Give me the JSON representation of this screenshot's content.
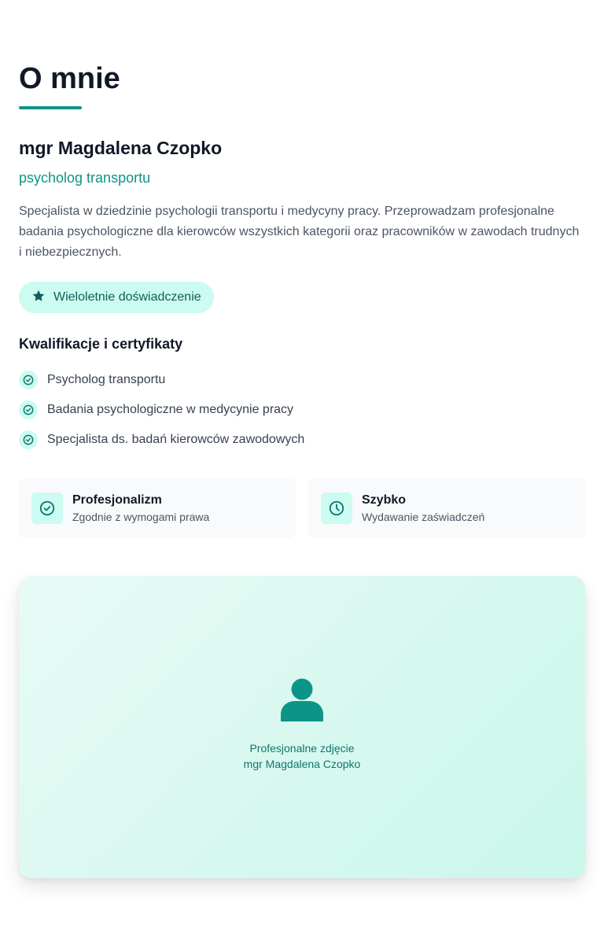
{
  "section": {
    "title": "O mnie"
  },
  "person": {
    "name": "mgr Magdalena Czopko",
    "role": "psycholog transportu",
    "description": "Specjalista w dziedzinie psychologii transportu i medycyny pracy. Przeprowadzam profesjonalne badania psychologiczne dla kierowców wszystkich kategorii oraz pracowników w zawodach trudnych i niebezpiecznych."
  },
  "badge": {
    "icon": "star-icon",
    "label": "Wieloletnie doświadczenie"
  },
  "qualifications": {
    "title": "Kwalifikacje i certyfikaty",
    "items": [
      "Psycholog transportu",
      "Badania psychologiczne w medycynie pracy",
      "Specjalista ds. badań kierowców zawodowych"
    ]
  },
  "features": [
    {
      "icon": "check-circle-icon",
      "title": "Profesjonalizm",
      "subtitle": "Zgodnie z wymogami prawa"
    },
    {
      "icon": "clock-icon",
      "title": "Szybko",
      "subtitle": "Wydawanie zaświadczeń"
    }
  ],
  "photo": {
    "icon": "user-icon",
    "caption_line1": "Profesjonalne zdjęcie",
    "caption_line2": "mgr Magdalena Czopko"
  },
  "colors": {
    "accent": "#0d9488",
    "accent_light": "#ccfbf1",
    "heading": "#111827",
    "body_text": "#4b5563"
  }
}
